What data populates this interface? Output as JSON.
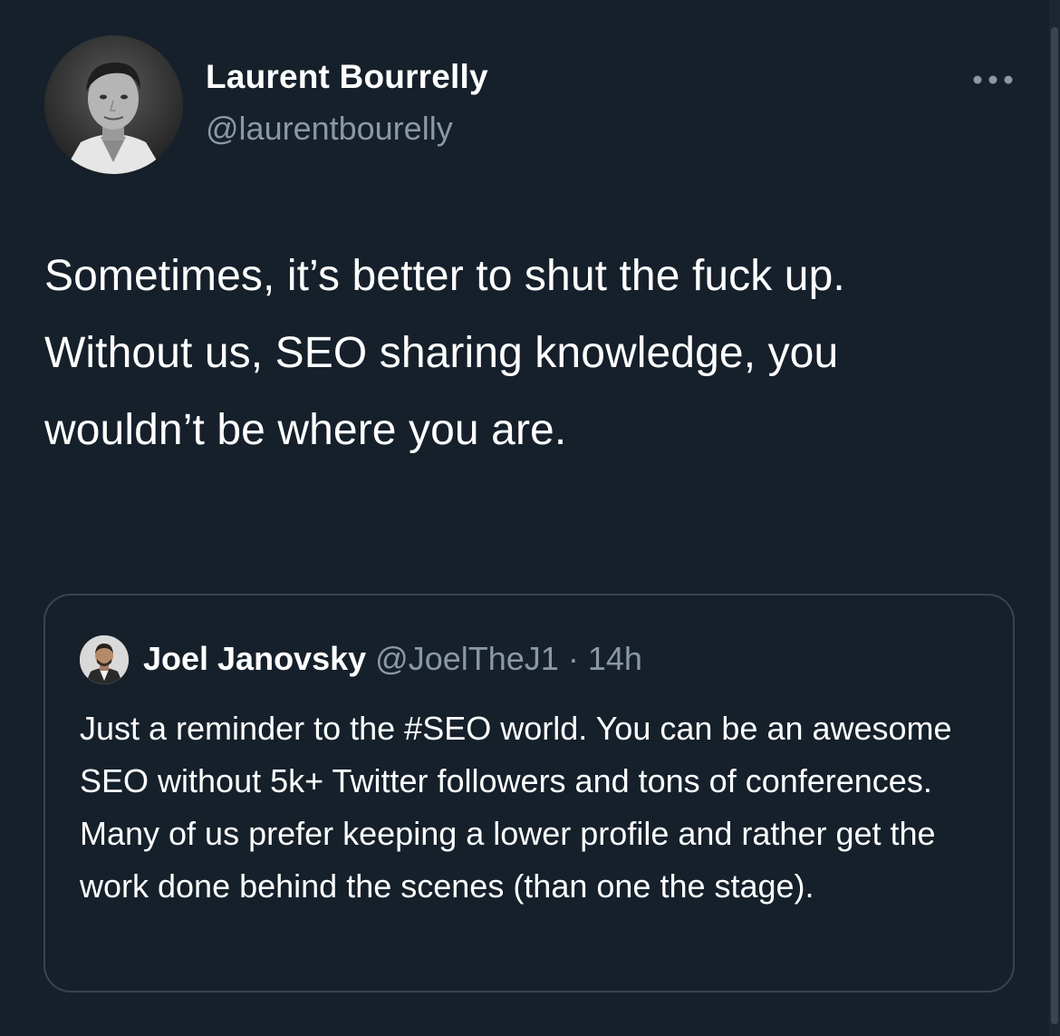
{
  "tweet": {
    "author": {
      "name": "Laurent Bourrelly",
      "handle": "@laurentbourelly"
    },
    "text": "Sometimes, it’s better to shut the fuck up. Without us, SEO sharing knowledge, you wouldn’t be where you are.",
    "more_icon": "more-horizontal-icon"
  },
  "quoted_tweet": {
    "author": {
      "name": "Joel Janovsky",
      "handle": "@JoelTheJ1"
    },
    "separator": "·",
    "time": "14h",
    "text": "Just a reminder to the #SEO world. You can be an awesome SEO without 5k+ Twitter followers and tons of conferences. Many of us prefer keeping a lower profile and rather get the work done behind the scenes (than one the stage)."
  },
  "colors": {
    "background": "#15202b",
    "primary_text": "#ffffff",
    "secondary_text": "#8b98a5",
    "border": "#38444d"
  }
}
